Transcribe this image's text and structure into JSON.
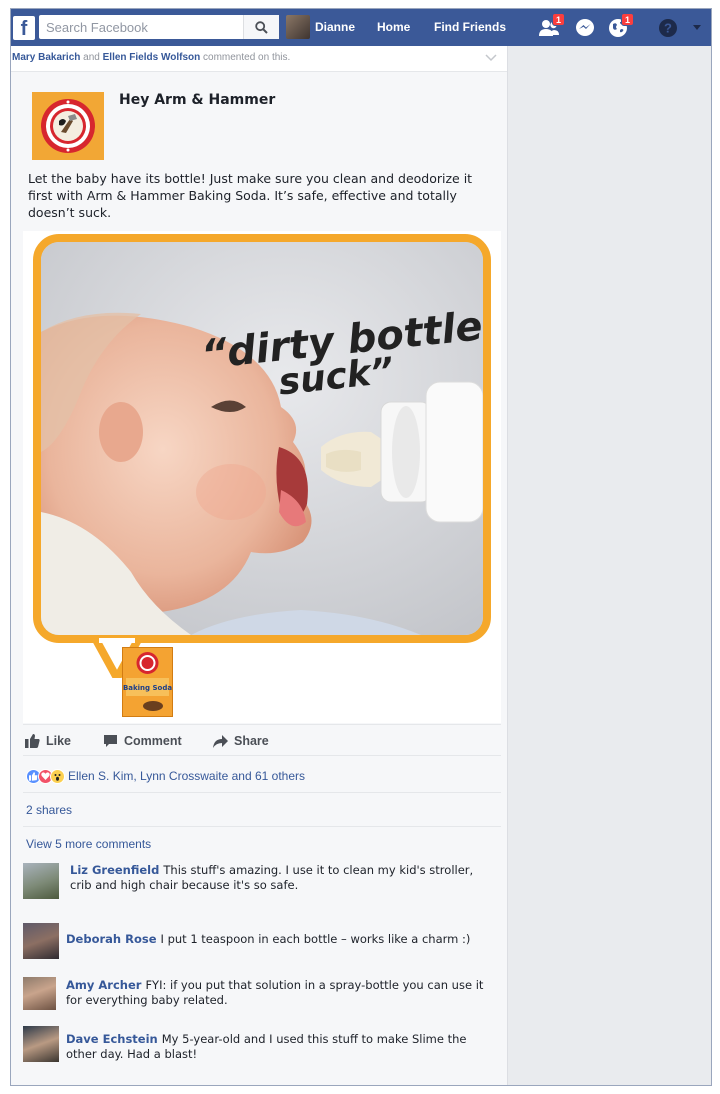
{
  "topbar": {
    "logo": "f",
    "search_placeholder": "Search Facebook",
    "profile_name": "Dianne",
    "home": "Home",
    "find_friends": "Find Friends",
    "friend_requests_count": "1",
    "notifications_count": "1"
  },
  "story": {
    "actor1": "Mary Bakarich",
    "and": "and",
    "actor2": "Ellen Fields Wolfson",
    "suffix": "commented on this."
  },
  "post": {
    "page_name": "Hey Arm & Hammer",
    "text": "Let the baby have its bottle! Just make sure you clean and deodorize it first with Arm & Hammer Baking Soda. It’s safe, effective and totally doesn’t suck.",
    "image_caption_line1": "“dirty bottles",
    "image_caption_line2": "suck”",
    "product_label": "Baking Soda"
  },
  "actions": {
    "like": "Like",
    "comment": "Comment",
    "share": "Share"
  },
  "reactions": {
    "names": "Ellen S. Kim, Lynn Crosswaite and 61 others"
  },
  "shares": "2 shares",
  "view_more_comments": "View 5 more comments",
  "comments": [
    {
      "name": "Liz Greenfield",
      "text": "This stuff's amazing. I use it to clean my kid's stroller, crib and high chair because it's so safe."
    },
    {
      "name": "Deborah Rose",
      "text": "I put 1 teaspoon in each bottle – works like a charm :)"
    },
    {
      "name": "Amy Archer",
      "text": "FYI: if you put that solution in a spray-bottle you can use it for everything baby related."
    },
    {
      "name": "Dave Echstein",
      "text": "My 5-year-old and I used this stuff to make Slime the other day. Had a blast!"
    }
  ],
  "colors": {
    "facebook_blue": "#3b5998",
    "link_blue": "#365899",
    "brand_orange": "#f5a82b"
  }
}
